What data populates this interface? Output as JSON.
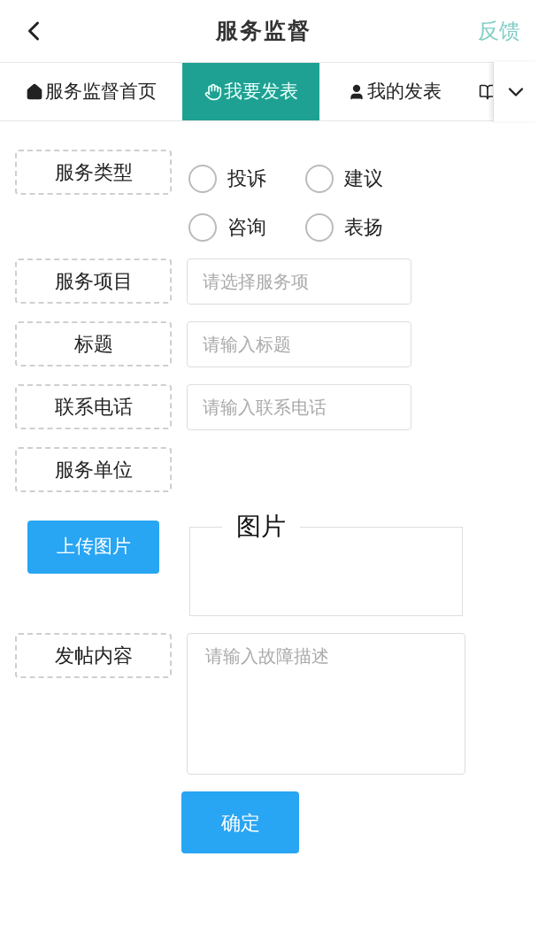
{
  "header": {
    "title": "服务监督",
    "action": "反馈"
  },
  "tabs": [
    {
      "label": "服务监督首页",
      "selected": false
    },
    {
      "label": "我要发表",
      "selected": true
    },
    {
      "label": "我的发表",
      "selected": false
    }
  ],
  "form": {
    "service_type": {
      "label": "服务类型",
      "options": [
        {
          "label": "投诉",
          "selected": false
        },
        {
          "label": "建议",
          "selected": false
        },
        {
          "label": "咨询",
          "selected": false
        },
        {
          "label": "表扬",
          "selected": false
        }
      ]
    },
    "fields": [
      {
        "label": "服务项目",
        "kind": "select",
        "placeholder": "请选择服务项"
      },
      {
        "label": "标题",
        "kind": "input",
        "placeholder": "请输入标题"
      },
      {
        "label": "联系电话",
        "kind": "input",
        "placeholder": "请输入联系电话"
      },
      {
        "label": "服务单位",
        "kind": "none"
      }
    ],
    "upload": {
      "button": "上传图片",
      "legend": "图片"
    },
    "content": {
      "label": "发帖内容",
      "placeholder": "请输入故障描述"
    },
    "submit": "确定"
  }
}
